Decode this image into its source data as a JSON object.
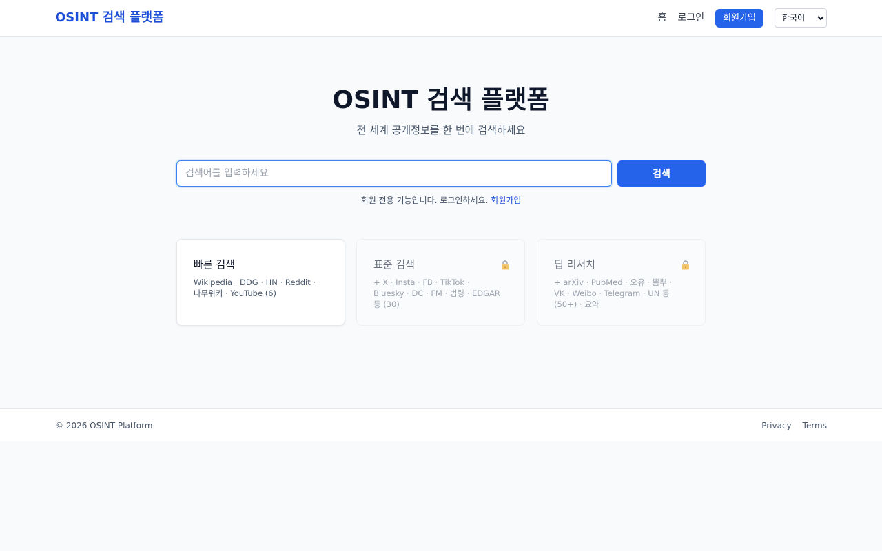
{
  "header": {
    "logo": "OSINT 검색 플랫폼",
    "nav_home": "홈",
    "nav_login": "로그인",
    "signup_label": "회원가입",
    "language_selected": "한국어"
  },
  "hero": {
    "title": "OSINT 검색 플랫폼",
    "subtitle": "전 세계 공개정보를 한 번에 검색하세요"
  },
  "search": {
    "placeholder": "검색어를 입력하세요",
    "value": "",
    "button_label": "검색"
  },
  "notice": {
    "text": "회원 전용 기능입니다. 로그인하세요.",
    "signup_link": "회원가입"
  },
  "cards": [
    {
      "title": "빠른 검색",
      "description": "Wikipedia · DDG · HN · Reddit · 나무위키 · YouTube (6)",
      "locked": false
    },
    {
      "title": "표준 검색",
      "description": "+ X · Insta · FB · TikTok · Bluesky · DC · FM · 법령 · EDGAR 등 (30)",
      "locked": true,
      "icon": "lock-icon"
    },
    {
      "title": "딥 리서치",
      "description": "+ arXiv · PubMed · 오유 · 뽐뿌 · VK · Weibo · Telegram · UN 등 (50+) · 요약",
      "locked": true,
      "icon": "lock-icon"
    }
  ],
  "footer": {
    "copyright": "© 2026 OSINT Platform",
    "privacy": "Privacy",
    "terms": "Terms"
  },
  "colors": {
    "accent": "#2563eb",
    "logo": "#1d4ed8",
    "background": "#f8fafc",
    "lock": "#d97706"
  }
}
